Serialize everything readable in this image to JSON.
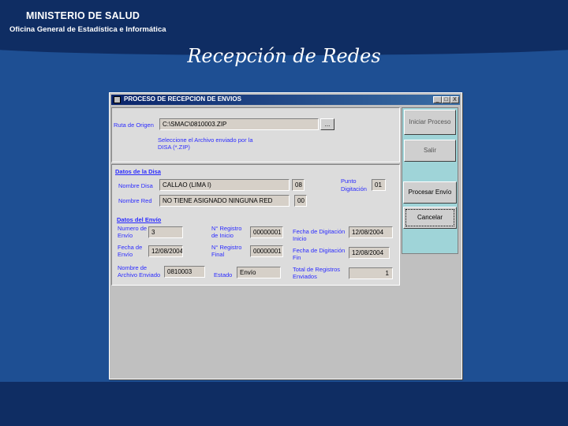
{
  "header": {
    "org": "MINISTERIO DE SALUD",
    "suborg": "Oficina General de Estadística e Informática",
    "slide_title": "Recepción de Redes"
  },
  "window": {
    "title": "PROCESO DE RECEPCION DE ENVIOS",
    "minimize": "_",
    "maximize": "□",
    "close": "X"
  },
  "origen": {
    "label": "Ruta de Origen",
    "value": "C:\\SMAC\\0810003.ZIP",
    "browse": "...",
    "hint1": "Seleccione el Archivo enviado por la",
    "hint2": "DISA (*.ZIP)"
  },
  "disa": {
    "section": "Datos de la Disa",
    "nombre_disa_label": "Nombre Disa",
    "nombre_disa": "CALLAO (LIMA I)",
    "nombre_disa_code": "08",
    "nombre_red_label": "Nombre Red",
    "nombre_red": "NO TIENE ASIGNADO NINGUNA RED",
    "nombre_red_code": "00",
    "punto_label1": "Punto",
    "punto_label2": "Digitación",
    "punto": "01"
  },
  "envio": {
    "section": "Datos del Envío",
    "numero_label1": "Numero de",
    "numero_label2": "Envío",
    "numero": "3",
    "fecha_label1": "Fecha de",
    "fecha_label2": "Envío",
    "fecha": "12/08/2004",
    "archivo_label1": "Nombre de",
    "archivo_label2": "Archivo Enviado",
    "archivo": "0810003",
    "reg_ini_label1": "N° Registro",
    "reg_ini_label2": "de Inicio",
    "reg_ini": "00000001",
    "reg_fin_label1": "N° Registro",
    "reg_fin_label2": "Final",
    "reg_fin": "00000001",
    "estado_label": "Estado",
    "estado": "Envío",
    "fdig_ini_label1": "Fecha de Digitación",
    "fdig_ini_label2": "Inicio",
    "fdig_ini": "12/08/2004",
    "fdig_fin_label1": "Fecha de Digitación",
    "fdig_fin_label2": "Fin",
    "fdig_fin": "12/08/2004",
    "total_label1": "Total de Registros",
    "total_label2": "Enviados",
    "total": "1"
  },
  "buttons": {
    "iniciar": "Iniciar Proceso",
    "salir": "Salir",
    "procesar": "Procesar Envío",
    "cancelar": "Cancelar"
  }
}
